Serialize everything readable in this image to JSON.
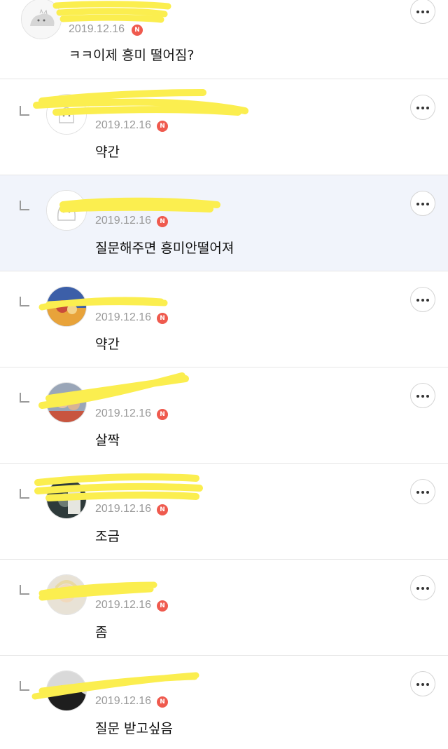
{
  "comments": [
    {
      "date": "2019.12.16",
      "badge": "N",
      "text": "ㅋㅋ이제 흥미 떨어짐?"
    },
    {
      "date": "2019.12.16",
      "badge": "N",
      "text": "약간"
    },
    {
      "date": "2019.12.16",
      "badge": "N",
      "text": "질문해주면 흥미안떨어져"
    },
    {
      "date": "2019.12.16",
      "badge": "N",
      "text": "약간"
    },
    {
      "date": "2019.12.16",
      "badge": "N",
      "text": "살짝"
    },
    {
      "date": "2019.12.16",
      "badge": "N",
      "text": "조금"
    },
    {
      "date": "2019.12.16",
      "badge": "N",
      "text": "좀"
    },
    {
      "date": "2019.12.16",
      "badge": "N",
      "text": "질문 받고싶음"
    }
  ],
  "colors": {
    "redaction": "#fbee4f",
    "badge": "#ef5a4e",
    "highlight_row": "#f1f4fb",
    "date_text": "#999999"
  },
  "icons": {
    "more": "more-horizontal-icon",
    "reply": "reply-arrow-icon",
    "new_badge": "new-badge"
  }
}
